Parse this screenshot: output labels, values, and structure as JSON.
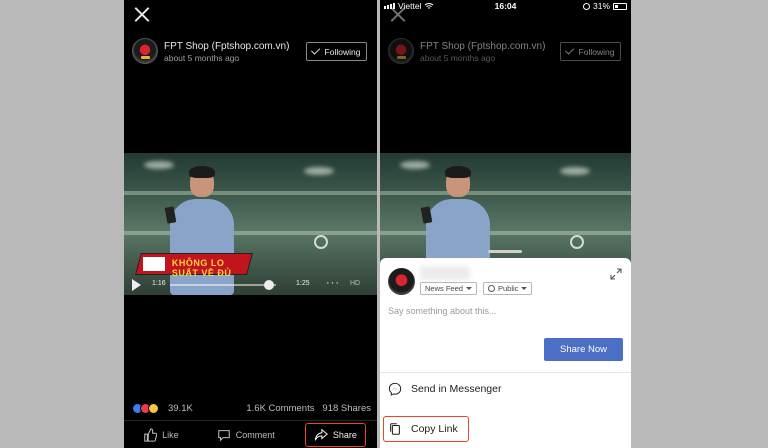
{
  "left": {
    "post": {
      "page_name": "FPT Shop (Fptshop.com.vn)",
      "time": "about 5 months ago",
      "following_label": "Following"
    },
    "video": {
      "banner_text": "KHÔNG LO SUẤT VỀ ĐỦ",
      "elapsed": "1:16",
      "duration": "1:25",
      "more": "···",
      "hd": "HD",
      "progress": 0.93
    },
    "stats": {
      "reaction_count": "39.1K",
      "comments": "1.6K Comments",
      "shares": "918 Shares"
    },
    "actions": {
      "like": "Like",
      "comment": "Comment",
      "share": "Share"
    }
  },
  "right": {
    "status_bar": {
      "carrier": "Viettel",
      "time": "16:04",
      "battery": "31%"
    },
    "post": {
      "page_name": "FPT Shop (Fptshop.com.vn)",
      "time": "about 5 months ago",
      "following_label": "Following"
    },
    "share_sheet": {
      "audience_feed": "News Feed",
      "audience_privacy": "Public",
      "placeholder": "Say something about this...",
      "share_now": "Share Now",
      "send_messenger": "Send in Messenger",
      "copy_link": "Copy Link"
    }
  },
  "colors": {
    "facebook_blue": "#4a6fc4",
    "highlight": "#e8452c",
    "like_blue": "#3b7cf0",
    "love_red": "#f0394f",
    "haha_yellow": "#f7c83c"
  }
}
